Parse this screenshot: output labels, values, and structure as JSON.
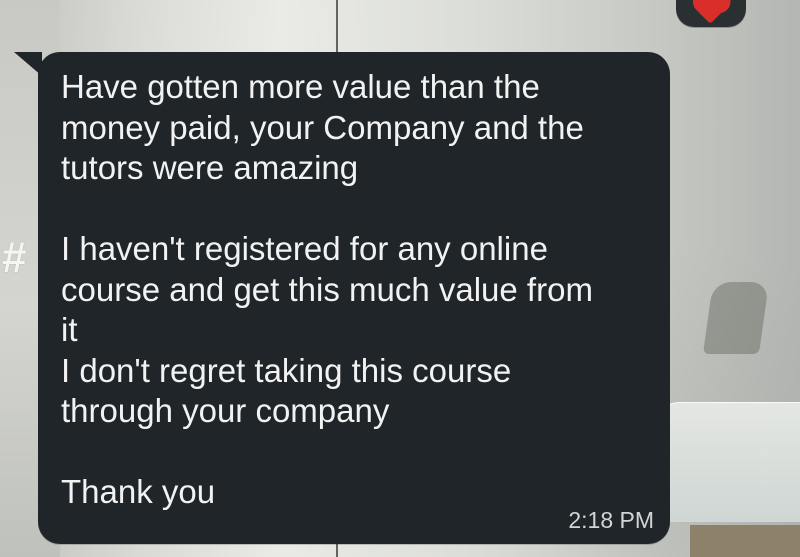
{
  "background": {
    "description_colors": {
      "bubble": "#1f2528",
      "heart": "#d92e2a",
      "text": "#f2f2f2",
      "timestamp": "#d2d5d7"
    }
  },
  "reaction": {
    "icon": "heart-icon"
  },
  "message": {
    "lines": [
      "Have gotten more value than the",
      "money paid, your Company and the",
      "tutors were amazing",
      "",
      "I haven't registered for any online",
      "course and get this much value from",
      "it",
      "I don't regret taking this course",
      "through your company",
      "",
      "Thank you"
    ],
    "time": "2:18 PM"
  }
}
